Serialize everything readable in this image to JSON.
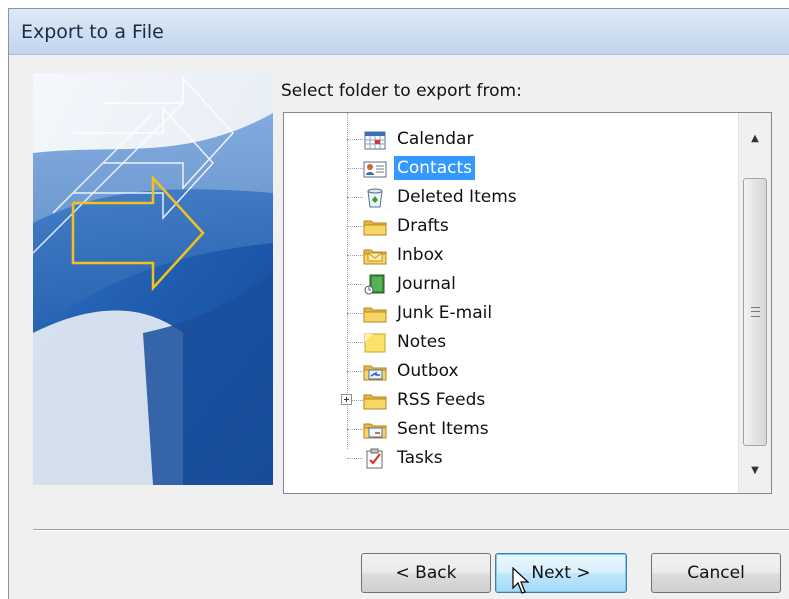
{
  "window": {
    "title": "Export to a File"
  },
  "prompt": "Select folder to export from:",
  "folders": [
    {
      "label": "Calendar",
      "icon": "calendar-icon",
      "selected": false,
      "expandable": false
    },
    {
      "label": "Contacts",
      "icon": "contacts-icon",
      "selected": true,
      "expandable": false
    },
    {
      "label": "Deleted Items",
      "icon": "recycle-bin-icon",
      "selected": false,
      "expandable": false
    },
    {
      "label": "Drafts",
      "icon": "folder-icon",
      "selected": false,
      "expandable": false
    },
    {
      "label": "Inbox",
      "icon": "inbox-folder-icon",
      "selected": false,
      "expandable": false
    },
    {
      "label": "Journal",
      "icon": "journal-icon",
      "selected": false,
      "expandable": false
    },
    {
      "label": "Junk E-mail",
      "icon": "folder-icon",
      "selected": false,
      "expandable": false
    },
    {
      "label": "Notes",
      "icon": "notes-icon",
      "selected": false,
      "expandable": false
    },
    {
      "label": "Outbox",
      "icon": "outbox-folder-icon",
      "selected": false,
      "expandable": false
    },
    {
      "label": "RSS Feeds",
      "icon": "folder-icon",
      "selected": false,
      "expandable": true
    },
    {
      "label": "Sent Items",
      "icon": "sent-items-folder-icon",
      "selected": false,
      "expandable": false
    },
    {
      "label": "Tasks",
      "icon": "tasks-icon",
      "selected": false,
      "expandable": false
    }
  ],
  "buttons": {
    "back": "< Back",
    "next": "Next >",
    "cancel": "Cancel"
  },
  "colors": {
    "selection": "#3399ff",
    "title_bar": "#cfdef2",
    "next_button_border": "#3c7fb1"
  }
}
